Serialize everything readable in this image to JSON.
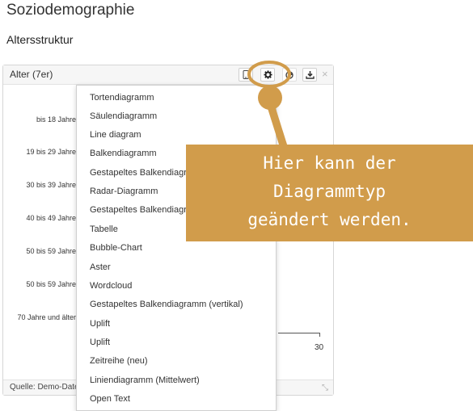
{
  "page": {
    "title": "Soziodemographie",
    "section": "Altersstruktur"
  },
  "panel": {
    "title": "Alter (7er)",
    "tools": [
      {
        "icon": "mobile-icon"
      },
      {
        "icon": "gear-icon"
      },
      {
        "icon": "pie-icon"
      },
      {
        "icon": "download-icon"
      }
    ],
    "close": "×",
    "y_labels": [
      "bis 18 Jahre",
      "19 bis 29 Jahre",
      "30 bis 39 Jahre",
      "40 bis 49 Jahre",
      "50 bis 59 Jahre",
      "50 bis 59 Jahre",
      "70 Jahre und älter"
    ],
    "axis_tick": "30",
    "source": "Quelle: Demo-Daten",
    "accent": "#8ecf8e"
  },
  "menu": {
    "items": [
      "Tortendiagramm",
      "Säulendiagramm",
      "Line diagram",
      "Balkendiagramm",
      "Gestapeltes Balkendiagramm",
      "Radar-Diagramm",
      "Gestapeltes Balkendiagramm",
      "Tabelle",
      "Bubble-Chart",
      "Aster",
      "Wordcloud",
      "Gestapeltes Balkendiagramm (vertikal)",
      "Uplift",
      "Uplift",
      "Zeitreihe (neu)",
      "Liniendiagramm (Mittelwert)",
      "Open Text"
    ]
  },
  "callout": {
    "lines": [
      "Hier kann der",
      "Diagrammtyp",
      "geändert werden."
    ],
    "color": "#d19c4b"
  }
}
